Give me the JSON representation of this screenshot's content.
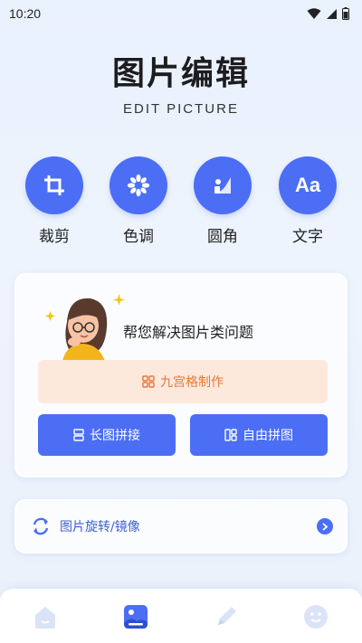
{
  "status_bar": {
    "time": "10:20"
  },
  "header": {
    "title": "图片编辑",
    "subtitle": "EDIT PICTURE"
  },
  "tools": [
    {
      "label": "裁剪",
      "icon": "crop-icon"
    },
    {
      "label": "色调",
      "icon": "tone-icon"
    },
    {
      "label": "圆角",
      "icon": "rounded-corner-icon"
    },
    {
      "label": "文字",
      "icon": "text-icon",
      "icon_text": "Aa"
    }
  ],
  "card": {
    "heading": "帮您解决图片类问题",
    "grid_button": "九宫格制作",
    "long_button": "长图拼接",
    "free_button": "自由拼图"
  },
  "rotate": {
    "label": "图片旋转/镜像"
  },
  "tabbar": {
    "items": [
      {
        "icon": "home-icon",
        "active": false
      },
      {
        "icon": "image-icon",
        "active": true
      },
      {
        "icon": "pen-icon",
        "active": false
      },
      {
        "icon": "smile-icon",
        "active": false
      }
    ]
  },
  "colors": {
    "accent": "#4b6ef5",
    "grid_bg": "#fde9dc",
    "grid_text": "#e8773d"
  }
}
